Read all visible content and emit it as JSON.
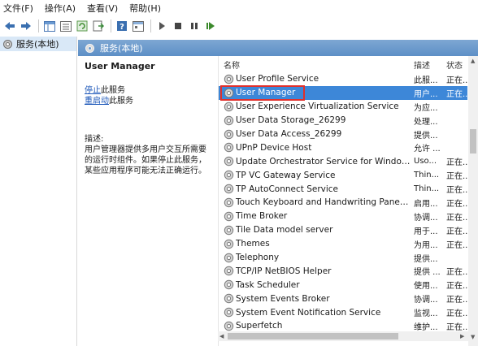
{
  "menubar": {
    "items": [
      "文件(F)",
      "操作(A)",
      "查看(V)",
      "帮助(H)"
    ]
  },
  "toolbar": {
    "buttons": [
      "back-icon",
      "forward-icon",
      "show-tree-icon",
      "list-view-icon",
      "refresh-icon",
      "export-icon",
      "help-icon",
      "properties-icon",
      "play-icon",
      "stop-icon",
      "pause-icon",
      "restart-icon"
    ]
  },
  "tree": {
    "root_label": "服务(本地)"
  },
  "pane": {
    "header_label": "服务(本地)"
  },
  "details": {
    "title": "User Manager",
    "stop_link": "停止",
    "stop_suffix": "此服务",
    "restart_link": "重启动",
    "restart_suffix": "此服务",
    "description_heading": "描述:",
    "description_text": "用户管理器提供多用户交互所需要的运行时组件。如果停止此服务，某些应用程序可能无法正确运行。"
  },
  "columns": {
    "name": "名称",
    "description": "描述",
    "status": "状态"
  },
  "services": [
    {
      "name": "User Profile Service",
      "desc": "此服...",
      "status": "正在..."
    },
    {
      "name": "User Manager",
      "desc": "用户...",
      "status": "正在...",
      "selected": true
    },
    {
      "name": "User Experience Virtualization Service",
      "desc": "为应...",
      "status": ""
    },
    {
      "name": "User Data Storage_26299",
      "desc": "处理...",
      "status": ""
    },
    {
      "name": "User Data Access_26299",
      "desc": "提供...",
      "status": ""
    },
    {
      "name": "UPnP Device Host",
      "desc": "允许 ...",
      "status": ""
    },
    {
      "name": "Update Orchestrator Service for Windows ...",
      "desc": "Uso...",
      "status": "正在..."
    },
    {
      "name": "TP VC Gateway Service",
      "desc": "Thin...",
      "status": "正在..."
    },
    {
      "name": "TP AutoConnect Service",
      "desc": "Thin...",
      "status": "正在..."
    },
    {
      "name": "Touch Keyboard and Handwriting Panel Ser...",
      "desc": "启用...",
      "status": "正在..."
    },
    {
      "name": "Time Broker",
      "desc": "协调...",
      "status": "正在..."
    },
    {
      "name": "Tile Data model server",
      "desc": "用于...",
      "status": "正在..."
    },
    {
      "name": "Themes",
      "desc": "为用...",
      "status": "正在..."
    },
    {
      "name": "Telephony",
      "desc": "提供...",
      "status": ""
    },
    {
      "name": "TCP/IP NetBIOS Helper",
      "desc": "提供 ...",
      "status": "正在..."
    },
    {
      "name": "Task Scheduler",
      "desc": "使用...",
      "status": "正在..."
    },
    {
      "name": "System Events Broker",
      "desc": "协调...",
      "status": "正在..."
    },
    {
      "name": "System Event Notification Service",
      "desc": "监视...",
      "status": "正在..."
    },
    {
      "name": "Superfetch",
      "desc": "维护...",
      "status": "正在..."
    }
  ],
  "colors": {
    "selection": "#3d87d8",
    "highlight_box": "#e0302c",
    "link": "#1a55b8",
    "pane_header": "#6b9acd"
  }
}
